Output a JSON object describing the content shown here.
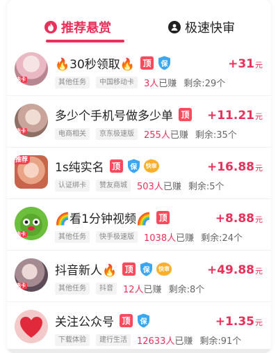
{
  "colors": {
    "accent": "#e8315a",
    "badge_top": "#ff4a5c",
    "badge_bao": "#3aa7f5",
    "badge_fast": "#ffae2b"
  },
  "tabs": [
    {
      "label": "推荐悬赏",
      "icon": "fire-icon",
      "active": true
    },
    {
      "label": "极速快审",
      "icon": "user-icon",
      "active": false
    }
  ],
  "tasks": [
    {
      "title": "🔥30秒领取🔥",
      "badges": [
        "顶",
        "保"
      ],
      "tags": [
        "其他任务",
        "中国移动卡"
      ],
      "earned_count": "3人",
      "earned_suffix": "已赚",
      "remaining": "剩余:29个",
      "reward_amount": "+31",
      "reward_unit": "元",
      "avatar_tag": "电卡"
    },
    {
      "title": "多少个手机号做多少单",
      "badges": [
        "顶"
      ],
      "tags": [
        "电商相关",
        "京东极速版"
      ],
      "earned_count": "255人",
      "earned_suffix": "已赚",
      "remaining": "剩余:35个",
      "reward_amount": "+11.21",
      "reward_unit": "元",
      "avatar_tag": "电卡"
    },
    {
      "title": "1s纯实名",
      "badges": [
        "顶",
        "保",
        "快审"
      ],
      "tags": [
        "认证绑卡",
        "赞友商城"
      ],
      "earned_count": "503人",
      "earned_suffix": "已赚",
      "remaining": "剩余:5个",
      "reward_amount": "+16.88",
      "reward_unit": "元",
      "avatar_tag": "推荐"
    },
    {
      "title": "🌈看1分钟视频🌈",
      "badges": [
        "顶"
      ],
      "tags": [
        "其他任务",
        "快手极速版"
      ],
      "earned_count": "1038人",
      "earned_suffix": "已赚",
      "remaining": "剩余:24个",
      "reward_amount": "+8.88",
      "reward_unit": "元",
      "avatar_tag": "电卡"
    },
    {
      "title": "抖音新人🔥",
      "badges": [
        "顶",
        "保",
        "快审"
      ],
      "tags": [
        "其他任务",
        "抖音"
      ],
      "earned_count": "12人",
      "earned_suffix": "已赚",
      "remaining": "剩余:8个",
      "reward_amount": "+49.88",
      "reward_unit": "元",
      "avatar_tag": "电卡"
    },
    {
      "title": "关注公众号",
      "badges": [
        "顶",
        "保"
      ],
      "tags": [
        "下载体验",
        "建行生活"
      ],
      "earned_count": "12633人",
      "earned_suffix": "已赚",
      "remaining": "剩余:91个",
      "reward_amount": "+1.35",
      "reward_unit": "元",
      "avatar_tag": ""
    }
  ]
}
